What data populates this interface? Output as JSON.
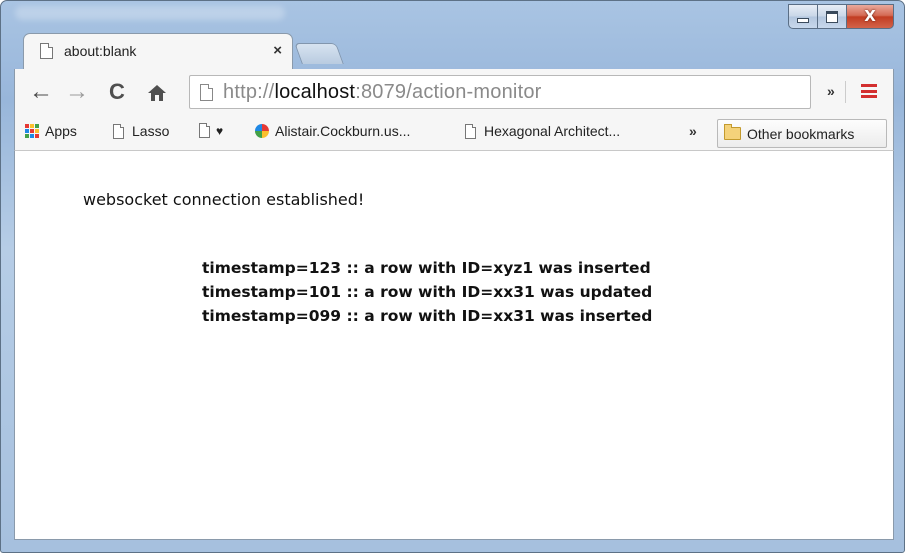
{
  "tab": {
    "title": "about:blank",
    "close_glyph": "×"
  },
  "window_controls": {
    "minimize": "minimize",
    "maximize": "maximize",
    "close": "X"
  },
  "toolbar": {
    "back_icon": "←",
    "forward_icon": "→",
    "reload_icon": "C",
    "home_icon": "🏠",
    "url_scheme": "http://",
    "url_host": "localhost",
    "url_rest": ":8079/action-monitor",
    "extensions_chevron": "»",
    "menu_icon": "hamburger-menu-icon"
  },
  "bookmarks": {
    "items": [
      {
        "label": "Apps",
        "icon": "apps-grid-icon"
      },
      {
        "label": "Lasso",
        "icon": "page-icon"
      },
      {
        "label": "♥",
        "icon": "page-icon"
      },
      {
        "label": "Alistair.Cockburn.us...",
        "icon": "globe-icon"
      },
      {
        "label": "Hexagonal Architect...",
        "icon": "page-icon"
      }
    ],
    "overflow_chevron": "»",
    "other_label": "Other bookmarks"
  },
  "page": {
    "status": "websocket connection established!",
    "log": [
      "timestamp=123 :: a row with ID=xyz1 was inserted",
      "timestamp=101 :: a row with ID=xx31 was updated",
      "timestamp=099 :: a row with ID=xx31 was inserted"
    ]
  }
}
